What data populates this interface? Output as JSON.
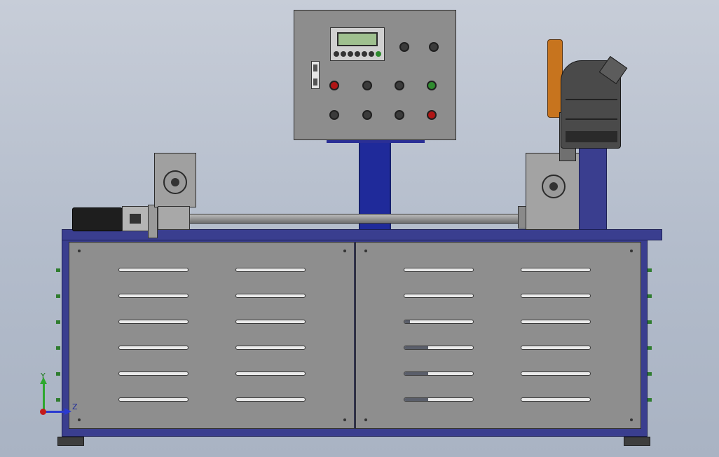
{
  "scene": {
    "description_type": "cad-viewport",
    "accent_colors": {
      "frame_blue": "#3a3e8f",
      "panel_gray": "#8c8c8c",
      "button_red": "#b01515",
      "button_green": "#2f8b2f",
      "blade_orange": "#c7741e",
      "lcd_green": "#9fc08f"
    }
  },
  "triad": {
    "y_label": "Y",
    "z_label": "Z"
  },
  "control_panel": {
    "lcd_text": "",
    "icons": [
      "switch-icon",
      "keypad-icon"
    ]
  }
}
